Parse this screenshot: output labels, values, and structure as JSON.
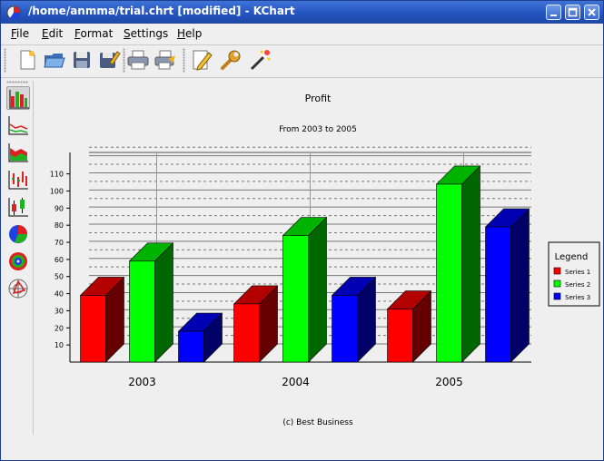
{
  "window": {
    "title": "/home/anmma/trial.chrt [modified] - KChart"
  },
  "menubar": [
    {
      "label": "File",
      "mnemonic": "F",
      "rest": "ile"
    },
    {
      "label": "Edit",
      "mnemonic": "E",
      "rest": "dit"
    },
    {
      "label": "Format",
      "mnemonic": "F",
      "rest": "ormat"
    },
    {
      "label": "Settings",
      "mnemonic": "S",
      "rest": "ettings"
    },
    {
      "label": "Help",
      "mnemonic": "H",
      "rest": "elp"
    }
  ],
  "toolbar": [
    "new-document-icon",
    "open-folder-icon",
    "save-icon",
    "save-as-icon",
    "print-icon",
    "print-preview-icon",
    "edit-data-icon",
    "configure-wrench-icon",
    "wizard-wand-icon"
  ],
  "side_toolbar": [
    "bar-chart-icon",
    "line-chart-icon",
    "area-chart-icon",
    "hilo-chart-icon",
    "box-whisker-icon",
    "pie-chart-icon",
    "ring-chart-icon",
    "polar-chart-icon"
  ],
  "chart_data": {
    "type": "bar",
    "title": "Profit",
    "subtitle": "From 2003 to 2005",
    "footer": "(c) Best Business",
    "categories": [
      "2003",
      "2004",
      "2005"
    ],
    "series": [
      {
        "name": "Series 1",
        "color": "#ff0000",
        "values": [
          39,
          34,
          31
        ]
      },
      {
        "name": "Series 2",
        "color": "#00ff00",
        "values": [
          59,
          74,
          104
        ]
      },
      {
        "name": "Series 3",
        "color": "#0000ff",
        "values": [
          18,
          39,
          79
        ]
      }
    ],
    "ylim": [
      0,
      122
    ],
    "yticks": [
      10,
      20,
      30,
      40,
      50,
      60,
      70,
      80,
      90,
      100,
      110
    ],
    "legend": {
      "title": "Legend",
      "position": "right"
    },
    "grid": true,
    "style": "3d"
  }
}
